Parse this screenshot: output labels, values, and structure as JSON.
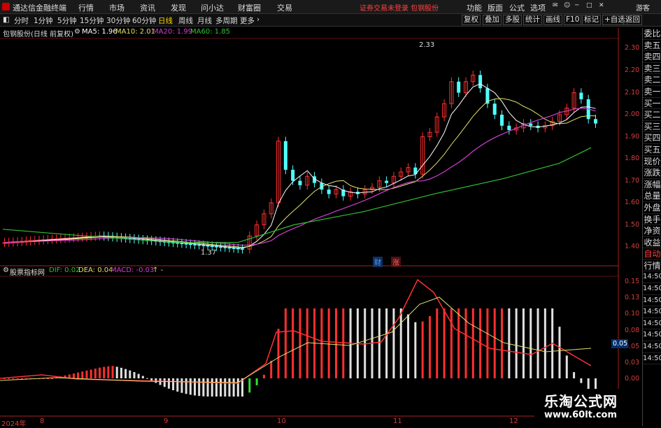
{
  "title_bar": {
    "app_title": "通达信金融终端",
    "menus": [
      "行情",
      "市场",
      "资讯",
      "发现",
      "问小达",
      "财富圈",
      "交易"
    ],
    "notice": "证券交易未登录  包钢股份",
    "right_menus": [
      "功能",
      "版面",
      "公式",
      "选项"
    ],
    "guest": "游客"
  },
  "toolbar": {
    "periods": [
      "分时",
      "1分钟",
      "5分钟",
      "15分钟",
      "30分钟",
      "60分钟",
      "日线",
      "周线",
      "月线",
      "多周期",
      "更多"
    ],
    "active_period": "日线",
    "right_buttons": [
      "复权",
      "叠加",
      "多股",
      "统计",
      "画线",
      "F10",
      "标记",
      "+自选",
      "返回"
    ]
  },
  "main_chart": {
    "stock_title": "包钢股份(日线 前复权)",
    "ma5": "MA5: 1.96",
    "ma10": "MA10: 2.01",
    "ma20": "MA20: 1.99",
    "ma60": "MA60: 1.85",
    "high_label": "2.33",
    "low_label": "1.37",
    "y_ticks": [
      "2.30",
      "2.20",
      "2.10",
      "2.00",
      "1.90",
      "1.80",
      "1.70",
      "1.60",
      "1.50",
      "1.40"
    ],
    "markers": [
      "财",
      "涨"
    ]
  },
  "macd_chart": {
    "indicator_name": "股票指标网",
    "dif": "DIF: 0.02",
    "dea": "DEA: 0.04",
    "macd": "MACD: -0.03",
    "arrow": "↑ -",
    "y_ticks": [
      "0.15",
      "0.13",
      "0.10",
      "0.08",
      "0.05",
      "0.03",
      "0.00"
    ],
    "current_value": "0.05"
  },
  "x_axis": {
    "labels": [
      "2024年",
      "8",
      "9",
      "10",
      "11",
      "12"
    ]
  },
  "right_panel": {
    "items": [
      "委比",
      "卖五",
      "卖四",
      "卖三",
      "卖二",
      "卖一",
      "买一",
      "买二",
      "买三",
      "买四",
      "买五",
      "现价",
      "涨跌",
      "涨幅",
      "总量",
      "外盘",
      "换手",
      "净资",
      "收益",
      "自动",
      "行情",
      "14:50",
      "14:50",
      "14:50",
      "14:50",
      "14:50",
      "14:50",
      "14:50",
      "14:50"
    ]
  },
  "watermark": {
    "line1": "乐淘公式网",
    "line2": "www.60lt.com"
  },
  "colors": {
    "up": "#ff3030",
    "down": "#50ffff",
    "ma5": "#ffffff",
    "ma10": "#e0e070",
    "ma20": "#d040d0",
    "ma60": "#30c030",
    "dif": "#ffffff",
    "dea": "#e0e070"
  }
}
